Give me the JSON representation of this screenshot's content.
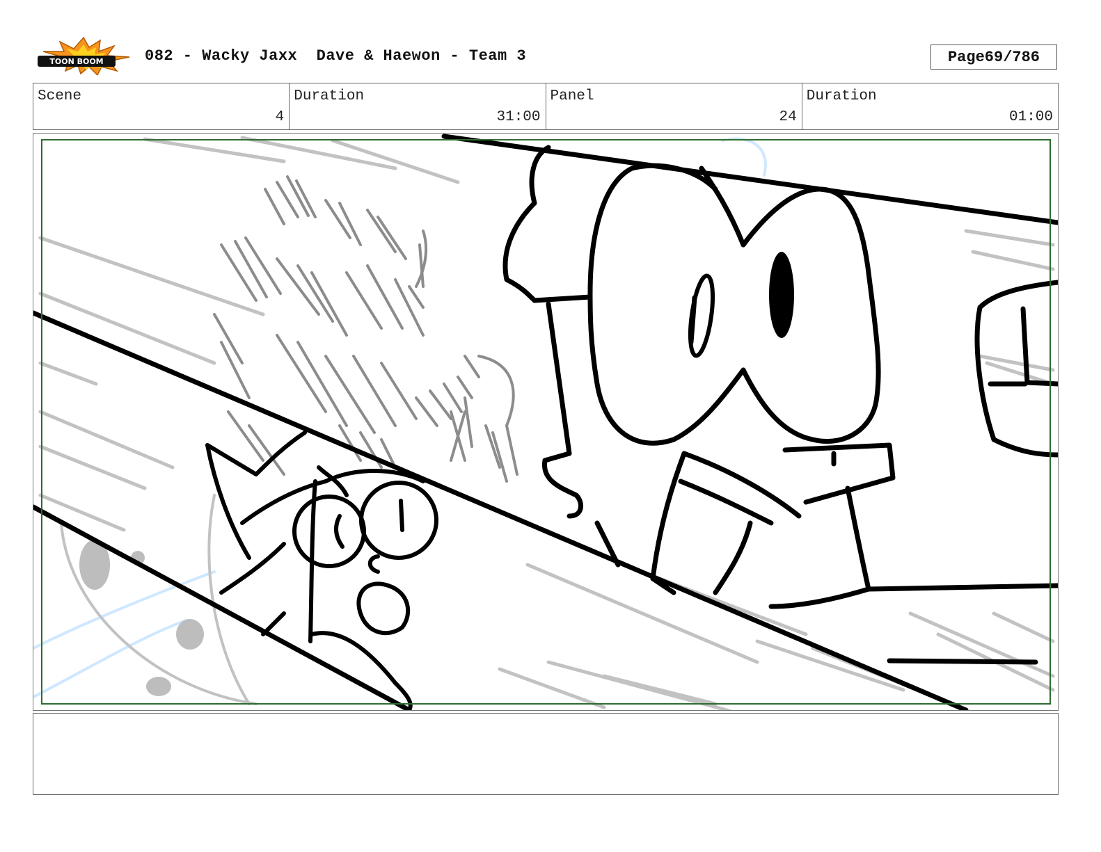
{
  "header": {
    "logo_text": "TOON BOOM",
    "title": "082 - Wacky Jaxx  Dave & Haewon - Team 3",
    "page_label": "Page",
    "page_value": "69/786"
  },
  "info": {
    "scene_label": "Scene",
    "scene_value": "4",
    "scene_duration_label": "Duration",
    "scene_duration_value": "31:00",
    "panel_label": "Panel",
    "panel_value": "24",
    "panel_duration_label": "Duration",
    "panel_duration_value": "01:00"
  },
  "notes": {
    "text": ""
  },
  "colors": {
    "safe_area": "#2e6b2e",
    "logo_orange": "#f7941d",
    "sketch_black": "#000000",
    "sketch_grey": "#bdbdbd",
    "sketch_blue": "#cfe8ff"
  }
}
